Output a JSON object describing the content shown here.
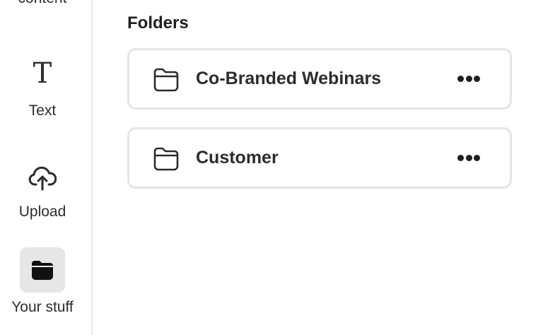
{
  "sidebar": {
    "items": [
      {
        "id": "add-content",
        "label": "content",
        "icon": "partial-item"
      },
      {
        "id": "text",
        "label": "Text",
        "icon": "text-icon",
        "glyph": "T"
      },
      {
        "id": "upload",
        "label": "Upload",
        "icon": "cloud-upload-icon"
      },
      {
        "id": "your-stuff",
        "label": "Your stuff",
        "icon": "folder-filled-icon",
        "selected": true
      }
    ]
  },
  "main": {
    "section_title": "Folders",
    "folders": [
      {
        "name": "Co-Branded Webinars",
        "icon": "folder-icon",
        "menu_icon": "more-icon"
      },
      {
        "name": "Customer",
        "icon": "folder-icon",
        "menu_icon": "more-icon"
      }
    ]
  },
  "colors": {
    "text": "#2c2c2c",
    "border": "#e5e5e5",
    "selected_bg": "#e6e6e6"
  }
}
